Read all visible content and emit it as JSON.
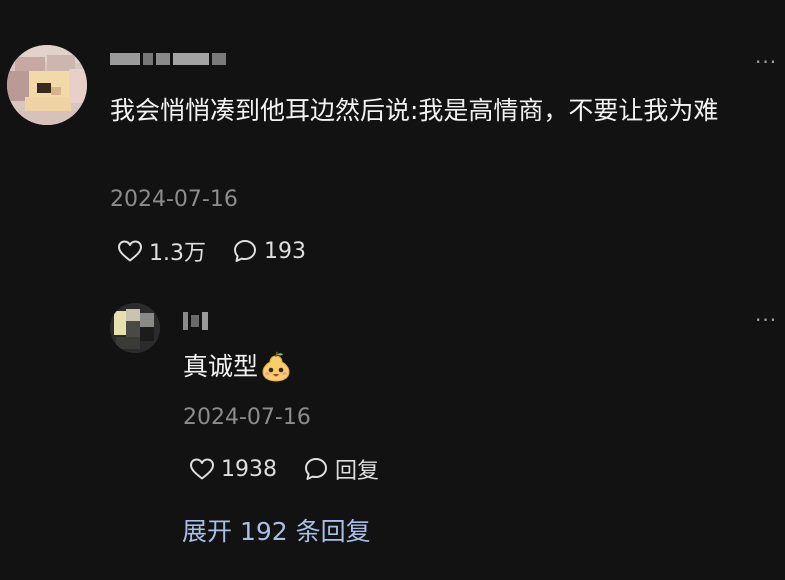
{
  "comment": {
    "text": "我会悄悄凑到他耳边然后说:我是高情商，不要让我为难",
    "date": "2024-07-16",
    "likes": "1.3万",
    "replies": "193",
    "more_label": "···"
  },
  "reply": {
    "text": "真诚型",
    "date": "2024-07-16",
    "likes": "1938",
    "reply_label": "回复",
    "more_label": "···"
  },
  "expand_label": "展开 192 条回复",
  "colors": {
    "background": "#121212",
    "text": "#f2f2f2",
    "meta": "#8c8c8c",
    "link": "#a9bfe6"
  }
}
